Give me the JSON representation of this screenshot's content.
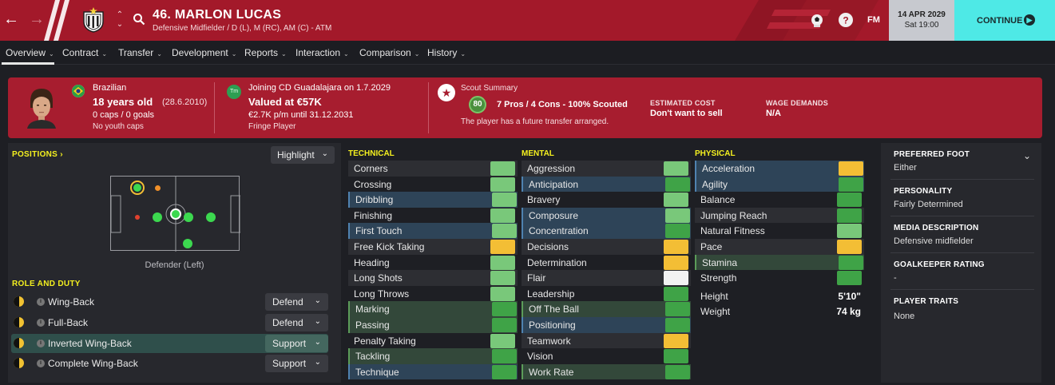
{
  "header": {
    "title": "46. MARLON LUCAS",
    "subtitle": "Defensive Midfielder / D (L), M (RC), AM (C) - ATM",
    "date": "14 APR 2029",
    "time": "Sat 19:00",
    "fm_label": "FM",
    "continue_label": "CONTINUE",
    "accent_color": "#a3192a",
    "continue_color": "#4ee9e6"
  },
  "tabs": [
    {
      "label": "Overview"
    },
    {
      "label": "Contract"
    },
    {
      "label": "Transfer"
    },
    {
      "label": "Development"
    },
    {
      "label": "Reports"
    },
    {
      "label": "Interaction"
    },
    {
      "label": "Comparison"
    },
    {
      "label": "History"
    }
  ],
  "info": {
    "nationality": "Brazilian",
    "age": "18 years old",
    "dob": "(28.6.2010)",
    "caps": "0 caps / 0 goals",
    "youth_caps": "No youth caps",
    "club_badge": "Tm",
    "joining": "Joining CD Guadalajara on 1.7.2029",
    "value": "Valued at €57K",
    "wage": "€2.7K p/m until 31.12.2031",
    "squad_status": "Fringe Player",
    "scout_label": "Scout Summary",
    "scout_rating": "80",
    "scout_summary": "7 Pros / 4 Cons - 100% Scouted",
    "scout_note": "The player has a future transfer arranged.",
    "est_cost_label": "ESTIMATED COST",
    "est_cost": "Don't want to sell",
    "wage_demands_label": "WAGE DEMANDS",
    "wage_demands": "N/A"
  },
  "positions": {
    "title": "POSITIONS",
    "highlight_label": "Highlight",
    "pitch_label": "Defender (Left)"
  },
  "roles": {
    "title": "ROLE AND DUTY",
    "items": [
      {
        "name": "Wing-Back",
        "duty": "Defend"
      },
      {
        "name": "Full-Back",
        "duty": "Defend"
      },
      {
        "name": "Inverted Wing-Back",
        "duty": "Support"
      },
      {
        "name": "Complete Wing-Back",
        "duty": "Support"
      }
    ]
  },
  "technical": {
    "title": "TECHNICAL",
    "items": [
      {
        "name": "Corners",
        "level": "mid"
      },
      {
        "name": "Crossing",
        "level": "mid"
      },
      {
        "name": "Dribbling",
        "level": "mid"
      },
      {
        "name": "Finishing",
        "level": "mid"
      },
      {
        "name": "First Touch",
        "level": "mid"
      },
      {
        "name": "Free Kick Taking",
        "level": "orange"
      },
      {
        "name": "Heading",
        "level": "mid"
      },
      {
        "name": "Long Shots",
        "level": "mid"
      },
      {
        "name": "Long Throws",
        "level": "mid"
      },
      {
        "name": "Marking",
        "level": "green"
      },
      {
        "name": "Passing",
        "level": "green"
      },
      {
        "name": "Penalty Taking",
        "level": "mid"
      },
      {
        "name": "Tackling",
        "level": "green"
      },
      {
        "name": "Technique",
        "level": "green"
      }
    ]
  },
  "mental": {
    "title": "MENTAL",
    "items": [
      {
        "name": "Aggression",
        "level": "mid"
      },
      {
        "name": "Anticipation",
        "level": "green"
      },
      {
        "name": "Bravery",
        "level": "mid"
      },
      {
        "name": "Composure",
        "level": "mid"
      },
      {
        "name": "Concentration",
        "level": "green"
      },
      {
        "name": "Decisions",
        "level": "orange"
      },
      {
        "name": "Determination",
        "level": "orange"
      },
      {
        "name": "Flair",
        "level": "white"
      },
      {
        "name": "Leadership",
        "level": "green"
      },
      {
        "name": "Off The Ball",
        "level": "green"
      },
      {
        "name": "Positioning",
        "level": "green"
      },
      {
        "name": "Teamwork",
        "level": "orange"
      },
      {
        "name": "Vision",
        "level": "green"
      },
      {
        "name": "Work Rate",
        "level": "green"
      }
    ]
  },
  "physical": {
    "title": "PHYSICAL",
    "items": [
      {
        "name": "Acceleration",
        "level": "orange"
      },
      {
        "name": "Agility",
        "level": "green"
      },
      {
        "name": "Balance",
        "level": "green"
      },
      {
        "name": "Jumping Reach",
        "level": "green"
      },
      {
        "name": "Natural Fitness",
        "level": "mid"
      },
      {
        "name": "Pace",
        "level": "orange"
      },
      {
        "name": "Stamina",
        "level": "green"
      },
      {
        "name": "Strength",
        "level": "green"
      }
    ],
    "height_label": "Height",
    "height": "5'10\"",
    "weight_label": "Weight",
    "weight": "74 kg"
  },
  "colors": {
    "green": "#3fa347",
    "mid": "#79c87a",
    "orange": "#f3be35",
    "white": "#f2f2f2"
  },
  "side": {
    "preferred_foot_label": "PREFERRED FOOT",
    "preferred_foot": "Either",
    "personality_label": "PERSONALITY",
    "personality": "Fairly Determined",
    "media_label": "MEDIA DESCRIPTION",
    "media": "Defensive midfielder",
    "gk_label": "GOALKEEPER RATING",
    "gk": "-",
    "traits_label": "PLAYER TRAITS",
    "traits": "None"
  }
}
